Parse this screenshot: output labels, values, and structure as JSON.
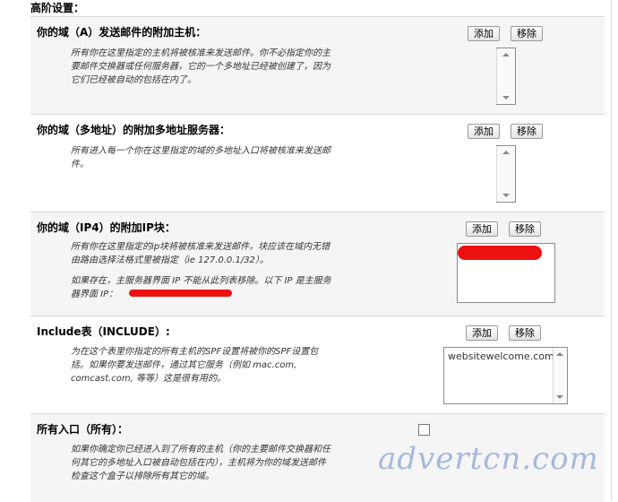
{
  "heading": "高阶设置：",
  "add_label": "添加",
  "remove_label": "移除",
  "sections": [
    {
      "title": "你的域（A）发送邮件的附加主机：",
      "desc": [
        "所有你在这里指定的主机将被核准来发送邮件。你不必指定你的主",
        "要邮件交换器或任何服务器，它的一个多地址已经被创建了，因为",
        "它们已经被自动的包括在内了。"
      ]
    },
    {
      "title": "你的域（多地址）的附加多地址服务器：",
      "desc": [
        "所有进入每一个你在这里指定的域的多地址入口将被核准来发送邮",
        "件。"
      ]
    },
    {
      "title": "你的域（IP4）的附加IP块：",
      "desc": [
        "所有你在这里指定的ip块将被核准来发送邮件，块应该在域内无错",
        "由路由选择法格式里被指定（ie 127.0.0.1/32）。",
        "",
        "如果存在，主服务器界面 IP 不能从此列表移除。以下 IP 是主服务",
        "器界面 IP："
      ]
    },
    {
      "title": "Include表（INCLUDE）:",
      "desc": [
        "为在这个表里你指定的所有主机的SPF设置将被你的SPF设置包",
        "括。如果你要发送邮件，通过其它服务（例如 mac.com,",
        "comcast.com, 等等）这是很有用的。"
      ],
      "value": "websitewelcome.com"
    },
    {
      "title": "所有入口（所有）：",
      "desc": [
        "如果你确定你已经进入到了所有的主机（你的主要邮件交换器和任",
        "何其它的多地址入口被自动包括在内），主机将为你的域发送邮件",
        "检查这个盒子以排除所有其它的域。"
      ]
    }
  ],
  "watermark": "advertcn.com"
}
